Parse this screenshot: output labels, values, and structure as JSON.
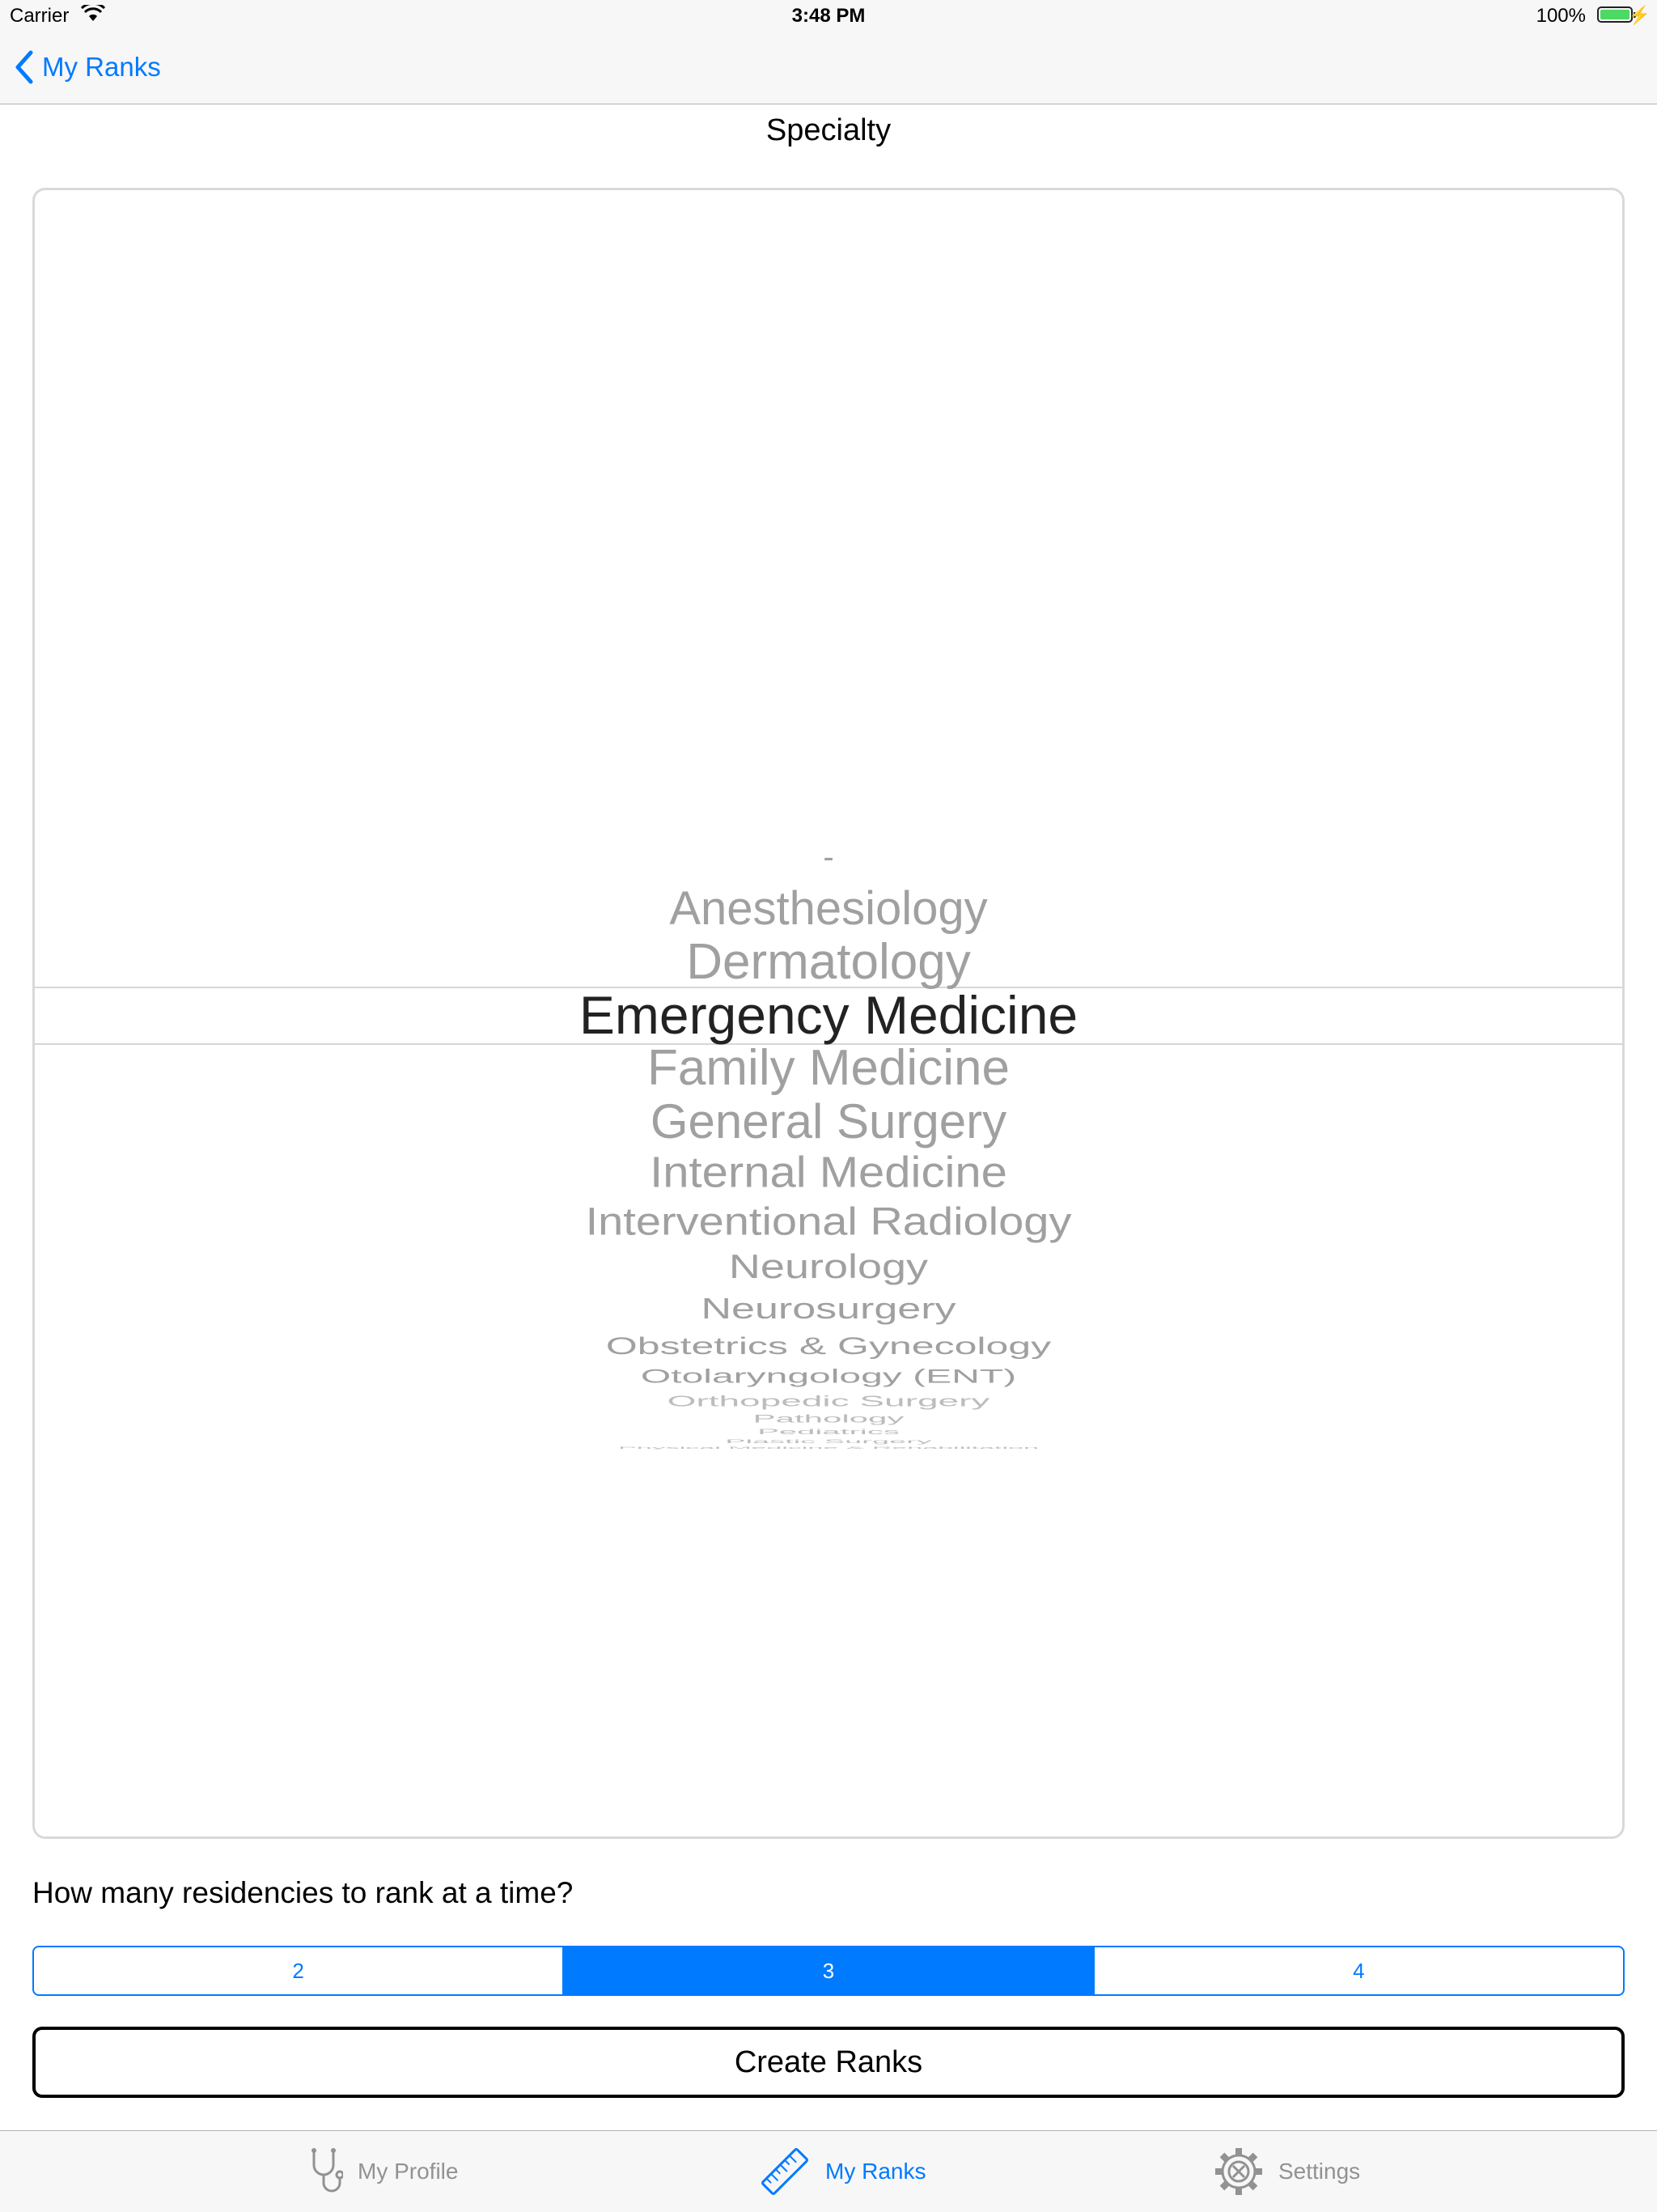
{
  "status_bar": {
    "carrier": "Carrier",
    "time": "3:48 PM",
    "battery": "100%"
  },
  "nav": {
    "back_label": "My Ranks"
  },
  "page": {
    "title": "Specialty"
  },
  "picker": {
    "selected_index": 3,
    "options": [
      "-",
      "Anesthesiology",
      "Dermatology",
      "Emergency Medicine",
      "Family Medicine",
      "General Surgery",
      "Internal Medicine",
      "Interventional Radiology",
      "Neurology",
      "Neurosurgery",
      "Obstetrics & Gynecology",
      "Otolaryngology (ENT)",
      "Orthopedic Surgery",
      "Pathology",
      "Pediatrics",
      "Plastic Surgery",
      "Physical Medicine & Rehabilitation"
    ]
  },
  "question": "How many residencies to rank at a time?",
  "segments": {
    "options": [
      "2",
      "3",
      "4"
    ],
    "selected": "3"
  },
  "create_button": "Create Ranks",
  "tabs": [
    {
      "label": "My Profile",
      "icon": "stethoscope-icon",
      "active": false
    },
    {
      "label": "My Ranks",
      "icon": "ruler-icon",
      "active": true
    },
    {
      "label": "Settings",
      "icon": "gear-icon",
      "active": false
    }
  ],
  "colors": {
    "accent": "#007aff",
    "battery": "#4cd964",
    "picker_text": "#a0a0a0",
    "selected_text": "#222222"
  }
}
